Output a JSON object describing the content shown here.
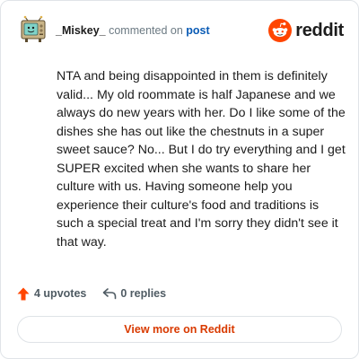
{
  "header": {
    "username": "_Miskey_",
    "action_text": "commented on",
    "post_link": "post",
    "brand_name": "reddit",
    "avatar_icon": "tv-robot-avatar-icon",
    "brand_icon": "reddit-snoo-icon"
  },
  "comment": {
    "text": "NTA and being disappointed in them is definitely valid... My old roommate is half Japanese and we always do new years with her. Do I like some of the dishes she has out like the chestnuts in a super sweet sauce? No... But I do try everything and I get SUPER excited when she wants to share her culture with us. Having someone help you experience their culture's food and traditions is such a special treat and I'm sorry they didn't see it that way."
  },
  "actions": {
    "upvotes_label": "4 upvotes",
    "upvote_icon": "upvote-arrow-icon",
    "replies_label": "0 replies",
    "reply_icon": "reply-arrow-icon"
  },
  "footer": {
    "view_more_label": "View more on Reddit"
  },
  "colors": {
    "accent": "#ff4500",
    "link": "#0a5bb5",
    "view_more_text": "#d93a00",
    "muted": "#6c7a83"
  }
}
